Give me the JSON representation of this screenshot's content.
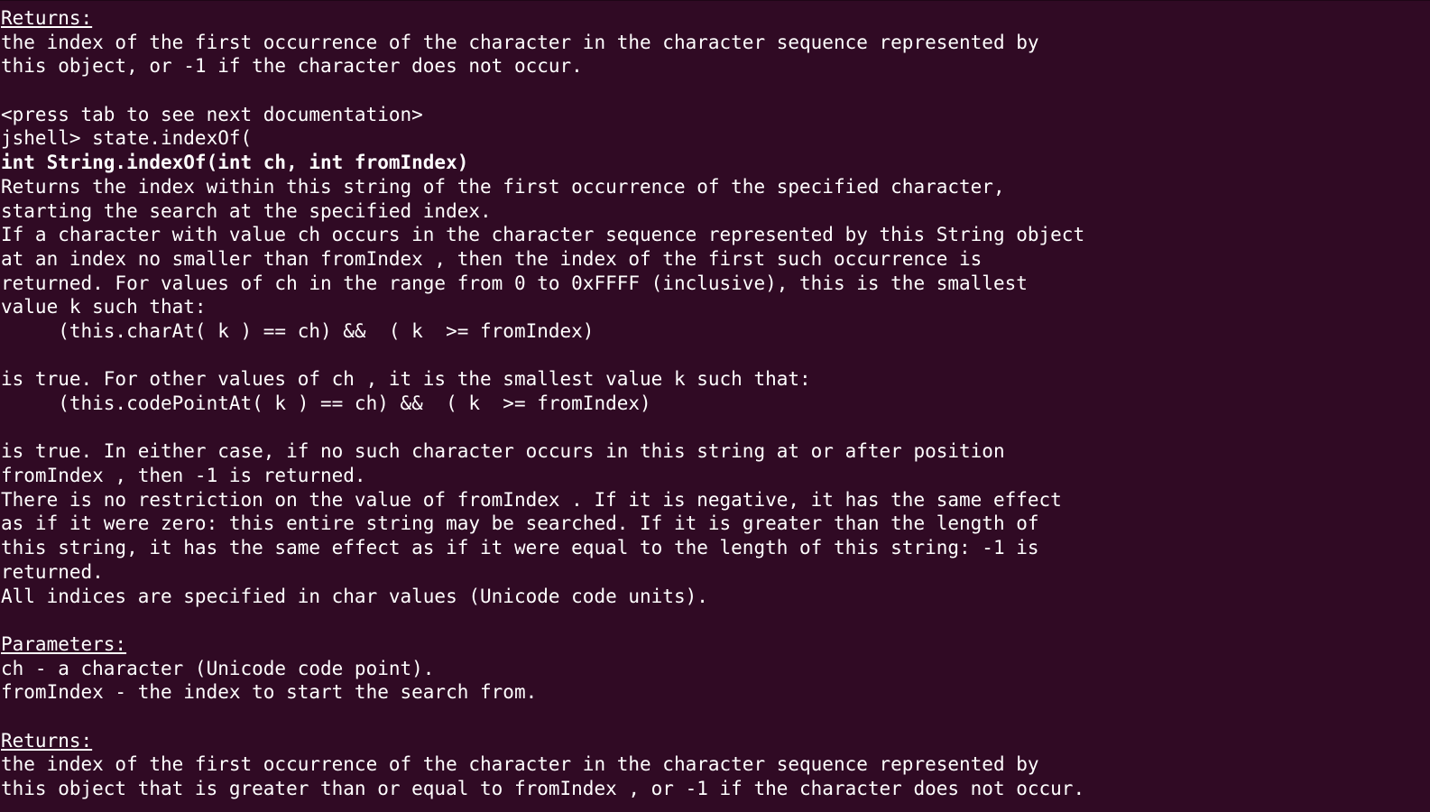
{
  "terminal": {
    "lines": [
      {
        "text": "Returns:",
        "style": "underline"
      },
      {
        "text": "the index of the first occurrence of the character in the character sequence represented by",
        "style": "normal"
      },
      {
        "text": "this object, or -1 if the character does not occur.",
        "style": "normal"
      },
      {
        "text": "",
        "style": "normal"
      },
      {
        "text": "<press tab to see next documentation>",
        "style": "normal"
      },
      {
        "text": "jshell> state.indexOf(",
        "style": "normal"
      },
      {
        "text": "int String.indexOf(int ch, int fromIndex)",
        "style": "bold"
      },
      {
        "text": "Returns the index within this string of the first occurrence of the specified character,",
        "style": "normal"
      },
      {
        "text": "starting the search at the specified index.",
        "style": "normal"
      },
      {
        "text": "If a character with value ch occurs in the character sequence represented by this String object",
        "style": "normal"
      },
      {
        "text": "at an index no smaller than fromIndex , then the index of the first such occurrence is",
        "style": "normal"
      },
      {
        "text": "returned. For values of ch in the range from 0 to 0xFFFF (inclusive), this is the smallest",
        "style": "normal"
      },
      {
        "text": "value k such that:",
        "style": "normal"
      },
      {
        "text": "     (this.charAt( k ) == ch) &&  ( k  >= fromIndex)",
        "style": "normal"
      },
      {
        "text": "",
        "style": "normal"
      },
      {
        "text": "is true. For other values of ch , it is the smallest value k such that:",
        "style": "normal"
      },
      {
        "text": "     (this.codePointAt( k ) == ch) &&  ( k  >= fromIndex)",
        "style": "normal"
      },
      {
        "text": "",
        "style": "normal"
      },
      {
        "text": "is true. In either case, if no such character occurs in this string at or after position",
        "style": "normal"
      },
      {
        "text": "fromIndex , then -1 is returned.",
        "style": "normal"
      },
      {
        "text": "There is no restriction on the value of fromIndex . If it is negative, it has the same effect",
        "style": "normal"
      },
      {
        "text": "as if it were zero: this entire string may be searched. If it is greater than the length of",
        "style": "normal"
      },
      {
        "text": "this string, it has the same effect as if it were equal to the length of this string: -1 is",
        "style": "normal"
      },
      {
        "text": "returned.",
        "style": "normal"
      },
      {
        "text": "All indices are specified in char values (Unicode code units).",
        "style": "normal"
      },
      {
        "text": "",
        "style": "normal"
      },
      {
        "text": "Parameters:",
        "style": "underline"
      },
      {
        "text": "ch - a character (Unicode code point).",
        "style": "normal"
      },
      {
        "text": "fromIndex - the index to start the search from.",
        "style": "normal"
      },
      {
        "text": "",
        "style": "normal"
      },
      {
        "text": "Returns:",
        "style": "underline"
      },
      {
        "text": "the index of the first occurrence of the character in the character sequence represented by",
        "style": "normal"
      },
      {
        "text": "this object that is greater than or equal to fromIndex , or -1 if the character does not occur.",
        "style": "normal"
      }
    ]
  },
  "colors": {
    "background": "#300a24",
    "foreground": "#ffffff"
  }
}
